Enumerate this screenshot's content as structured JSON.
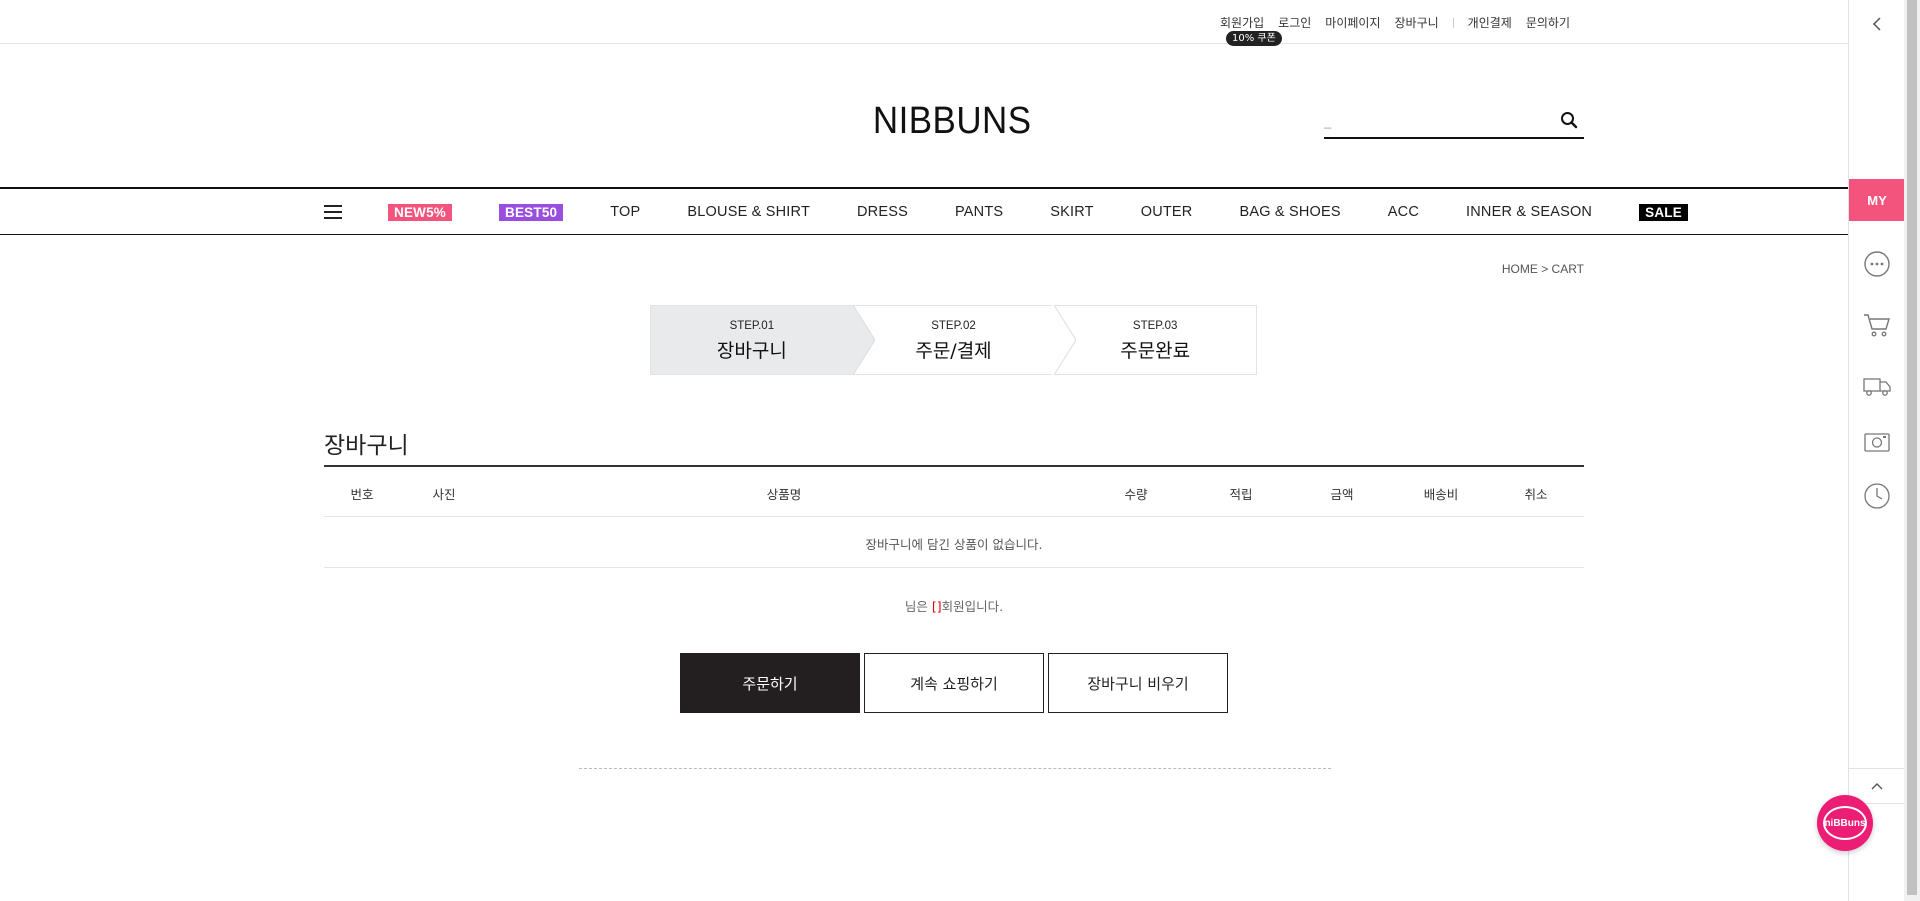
{
  "top_links": [
    {
      "label": "회원가입"
    },
    {
      "label": "로그인"
    },
    {
      "label": "마이페이지"
    },
    {
      "label": "장바구니"
    },
    {
      "label": "개인결제"
    },
    {
      "label": "문의하기"
    }
  ],
  "coupon_badge": "10% 쿠폰",
  "logo": "NIBBUNS",
  "search": {
    "value": "_",
    "icon": "search-icon"
  },
  "nav": {
    "menu_icon": "hamburger-icon",
    "items": [
      {
        "label": "NEW5%",
        "badge_color": "#f2547e"
      },
      {
        "label": "BEST50",
        "badge_color": "#9a4ee0"
      },
      {
        "label": "TOP"
      },
      {
        "label": "BLOUSE & SHIRT"
      },
      {
        "label": "DRESS"
      },
      {
        "label": "PANTS"
      },
      {
        "label": "SKIRT"
      },
      {
        "label": "OUTER"
      },
      {
        "label": "BAG & SHOES"
      },
      {
        "label": "ACC"
      },
      {
        "label": "INNER & SEASON"
      },
      {
        "label": "SALE",
        "badge_color": "#000000"
      }
    ]
  },
  "breadcrumb": "HOME > CART",
  "steps": [
    {
      "num": "STEP.01",
      "label": "장바구니",
      "active": true
    },
    {
      "num": "STEP.02",
      "label": "주문/결제",
      "active": false
    },
    {
      "num": "STEP.03",
      "label": "주문완료",
      "active": false
    }
  ],
  "cart": {
    "title": "장바구니",
    "columns": [
      "번호",
      "사진",
      "상품명",
      "수량",
      "적립",
      "금액",
      "배송비",
      "취소"
    ],
    "empty_message": "장바구니에 담긴 상품이 없습니다.",
    "member_note_prefix": "님은 ",
    "member_note_bracket": "[]",
    "member_note_suffix": "회원입니다."
  },
  "buttons": {
    "order": "주문하기",
    "continue": "계속 쇼핑하기",
    "clear": "장바구니 비우기"
  },
  "quickbar": {
    "my_label": "MY",
    "icons": [
      "chevron-left-icon",
      "chat-bubble-icon",
      "cart-icon",
      "delivery-truck-icon",
      "camera-icon",
      "clock-icon",
      "chevron-up-icon"
    ]
  },
  "chat_fab": {
    "label": "niBBuns",
    "color": "#ec1d75"
  },
  "accent_color": "#f2547e"
}
